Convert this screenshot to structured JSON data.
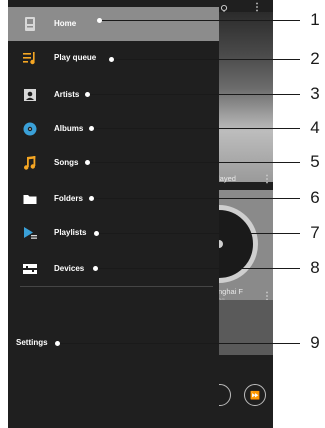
{
  "drawer": {
    "items": [
      {
        "label": "Home",
        "icon": "home-icon",
        "callout": "1"
      },
      {
        "label": "Play queue",
        "icon": "play-queue-icon",
        "callout": "2"
      },
      {
        "label": "Artists",
        "icon": "artists-icon",
        "callout": "3"
      },
      {
        "label": "Albums",
        "icon": "albums-icon",
        "callout": "4"
      },
      {
        "label": "Songs",
        "icon": "songs-icon",
        "callout": "5"
      },
      {
        "label": "Folders",
        "icon": "folders-icon",
        "callout": "6"
      },
      {
        "label": "Playlists",
        "icon": "playlists-icon",
        "callout": "7"
      },
      {
        "label": "Devices",
        "icon": "devices-icon",
        "callout": "8"
      }
    ],
    "settings": {
      "label": "Settings",
      "callout": "9"
    },
    "selected_index": 0
  },
  "background": {
    "text_played": "layed",
    "text_track": "nghai F",
    "text_sub": "ng"
  },
  "colors": {
    "accent": "#f5a623",
    "drawer_bg": "#1f1f1f",
    "selected_bg": "#8c8c8c"
  }
}
